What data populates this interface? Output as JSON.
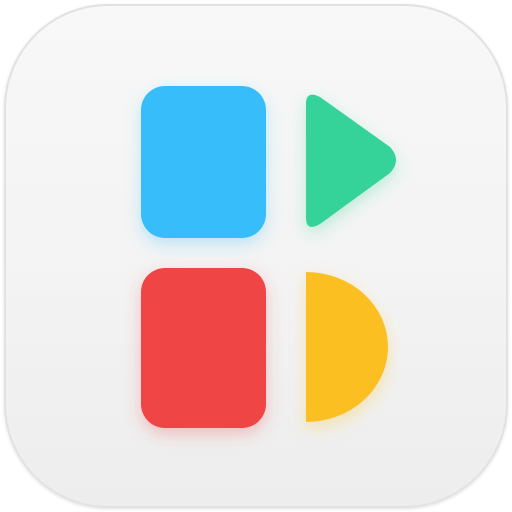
{
  "app_icon": {
    "colors": {
      "tile_background": "#f3f3f3",
      "tile_border": "#e2e2e2",
      "blue_block": "#38bdfb",
      "green_triangle": "#34d399",
      "red_block": "#ef4444",
      "yellow_half_circle": "#fbbf24"
    },
    "shapes": [
      {
        "name": "blue-rounded-rectangle",
        "color_key": "blue_block"
      },
      {
        "name": "green-triangle",
        "color_key": "green_triangle"
      },
      {
        "name": "red-rounded-rectangle",
        "color_key": "red_block"
      },
      {
        "name": "yellow-half-circle",
        "color_key": "yellow_half_circle"
      }
    ]
  }
}
